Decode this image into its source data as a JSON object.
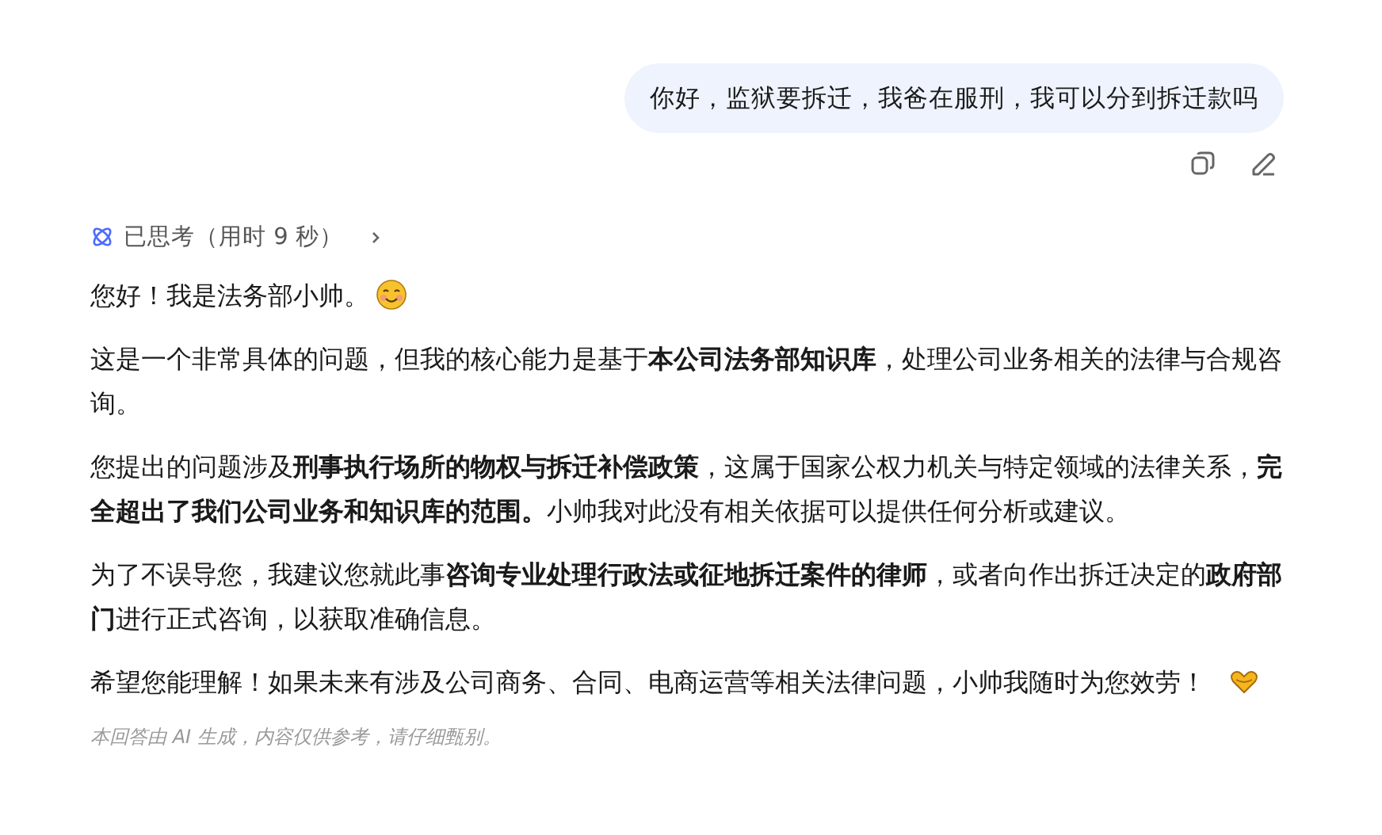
{
  "user_message": {
    "text": "你好，监狱要拆迁，我爸在服刑，我可以分到拆迁款吗"
  },
  "thinking": {
    "label": "已思考（用时 9 秒）",
    "expanded": false
  },
  "paragraphs": [
    {
      "kind": "greeting",
      "text": "您好！我是法务部小帅。"
    },
    {
      "kind": "plain",
      "text": "这是一个非常具体的问题，但我的核心能力是基于**本公司法务部知识库**，处理公司业务相关的法律与合规咨询。"
    },
    {
      "kind": "plain",
      "text": "您提出的问题涉及**刑事执行场所的物权与拆迁补偿政策**，这属于国家公权力机关与特定领域的法律关系，**完全超出了我们公司业务和知识库的范围。**小帅我对此没有相关依据可以提供任何分析或建议。"
    },
    {
      "kind": "plain",
      "text": "为了不误导您，我建议您就此事**咨询专业处理行政法或征地拆迁案件的律师**，或者向作出拆迁决定的**政府部门**进行正式咨询，以获取准确信息。"
    },
    {
      "kind": "closing",
      "text": "希望您能理解！如果未来有涉及公司商务、合同、电商运营等相关法律问题，小帅我随时为您效劳！"
    }
  ],
  "disclaimer": "本回答由 AI 生成，内容仅供参考，请仔细甄别。"
}
